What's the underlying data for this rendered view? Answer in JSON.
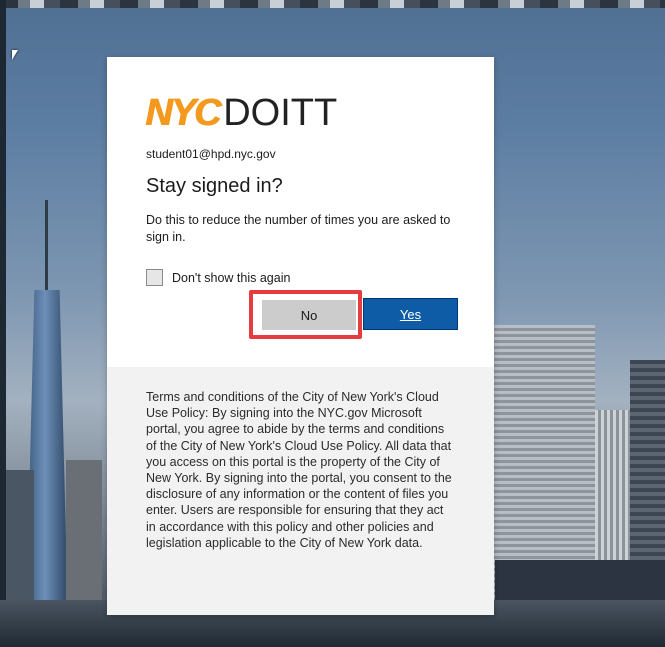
{
  "background": {
    "description_color_sky": "#5d7ea3"
  },
  "logo": {
    "nyc": "NYC",
    "doitt": "DOITT"
  },
  "account": {
    "email": "student01@hpd.nyc.gov"
  },
  "dialog": {
    "title": "Stay signed in?",
    "description": "Do this to reduce the number of times you are asked to sign in.",
    "checkbox_label": "Don't show this again",
    "no_label": "No",
    "yes_label": "Yes"
  },
  "terms": {
    "text": "Terms and conditions of the City of New York's Cloud Use Policy: By signing into the NYC.gov Microsoft portal, you agree to abide by the terms and conditions of the City of New York's Cloud Use Policy. All data that you access on this portal is the property of the City of New York. By signing into the portal, you consent to the disclosure of any information or the content of files you enter. Users are responsible for ensuring that they act in accordance with this policy and other policies and legislation applicable to the City of New York data."
  },
  "colors": {
    "accent_blue": "#0e5ca6",
    "highlight_red": "#e63b3f",
    "logo_orange": "#f39a1e"
  }
}
